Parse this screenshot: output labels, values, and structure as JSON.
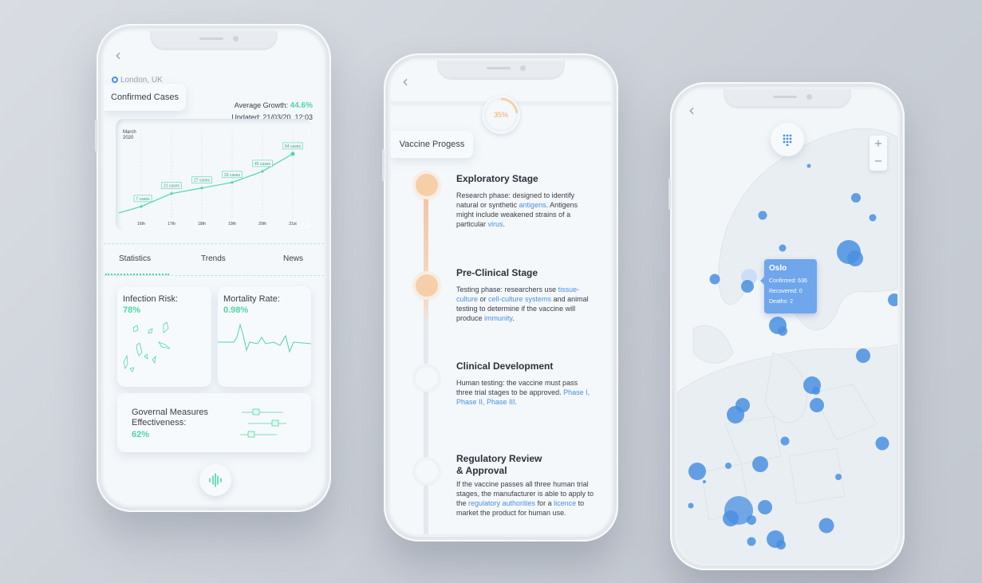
{
  "colors": {
    "accent_green": "#4fd6a6",
    "accent_orange": "#f2a766",
    "link_blue": "#4a8fe0",
    "bubble_blue": "#4a8fe0"
  },
  "phone1": {
    "location": "London, UK",
    "card_title": "Confirmed Cases",
    "growth_label": "Average Growth:",
    "growth_value": "44.6%",
    "updated": "Updated: 21/03/20, 12:03",
    "chart_header_month": "March",
    "chart_header_year": "2020",
    "tabs": [
      "Statistics",
      "Trends",
      "News"
    ],
    "infection_label": "Infection Risk:",
    "infection_value": "78%",
    "mortality_label": "Mortality Rate:",
    "mortality_value": "0.98%",
    "measures_label_1": "Governal Measures",
    "measures_label_2": "Effectiveness:",
    "measures_value": "62%"
  },
  "chart_data": {
    "type": "line",
    "x": [
      "16th",
      "17th",
      "18th",
      "19th",
      "20th",
      "21st"
    ],
    "values": [
      7,
      21,
      27,
      33,
      45,
      64
    ],
    "labels": [
      "7 cases",
      "21 cases",
      "27 cases",
      "33 cases",
      "45 cases",
      "64 cases"
    ],
    "title": "March 2020"
  },
  "phone2": {
    "progress": "35%",
    "card_title": "Vaccine Progess",
    "stages": [
      {
        "title": "Exploratory Stage",
        "t1": "Research phase: designed to identify natural or synthetic ",
        "l1": "antigens",
        "t2": ". Antigens might include weakened strains of a particular ",
        "l2": "virus",
        "t3": "."
      },
      {
        "title": "Pre-Clinical Stage",
        "t1": "Testing phase: researchers use ",
        "l1": "tissue-culture",
        "t2": " or ",
        "l2": "cell-culture systems",
        "t3": " and animal testing to determine if the vaccine will produce ",
        "l3": "immunity",
        "t4": "."
      },
      {
        "title": "Clinical Development",
        "t1": "Human testing: the vaccine must pass three trial stages to be approved. ",
        "l1": "Phase I, Phase II, Phase III",
        "t2": "."
      },
      {
        "title_1": "Regulatory Review",
        "title_2": "& Approval",
        "t1": "If the vaccine passes all three human trial stages, the manufacturer is able to apply to the ",
        "l1": "regulatory authorities",
        "t2": " for a ",
        "l2": "licence",
        "t3": " to market the product for human use."
      }
    ]
  },
  "phone3": {
    "zoom_in": "+",
    "zoom_out": "−",
    "tooltip_city": "Oslo",
    "tooltip_confirmed": "Confirmed: 636",
    "tooltip_recovered": "Recovered: 0",
    "tooltip_deaths": "Deaths: 2"
  }
}
